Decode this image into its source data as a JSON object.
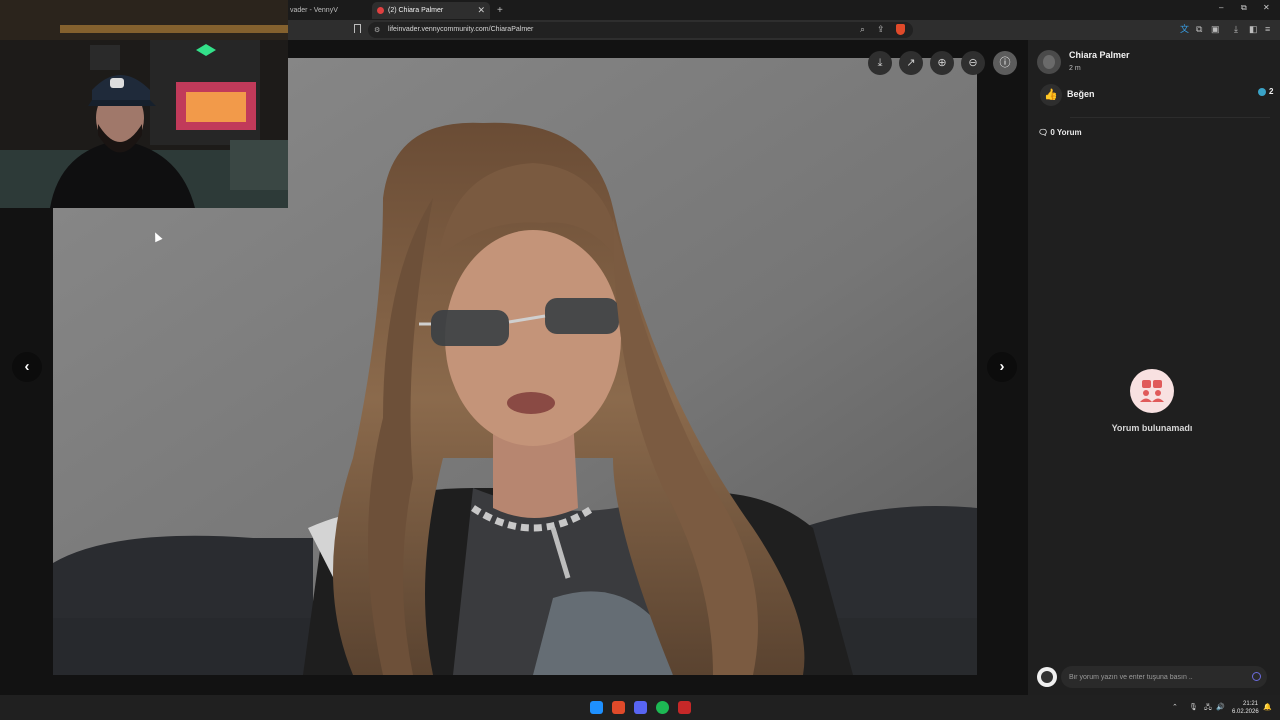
{
  "browser": {
    "tabs": [
      {
        "title": "vader - VennyV",
        "active": false
      },
      {
        "title": "(2) Chiara Palmer",
        "active": true
      }
    ],
    "url": "lifeinvader.vennycommunity.com/ChiaraPalmer",
    "window_controls": [
      "–",
      "⧉",
      "✕"
    ]
  },
  "viewer": {
    "controls": [
      "download-icon",
      "open-external-icon",
      "zoom-in-icon",
      "zoom-out-icon",
      "info-icon"
    ],
    "prev_arrow": "‹",
    "next_arrow": "›"
  },
  "post": {
    "author": "Chiara Palmer",
    "time": "2 m",
    "like_label": "Beğen",
    "like_count": "2",
    "comments_title": "0 Yorum",
    "empty_text": "Yorum bulunamadı",
    "comment_placeholder": "Bir yorum yazın ve enter tuşuna basın .."
  },
  "taskbar": {
    "time": "21:21",
    "date": "6.02.2026"
  },
  "colors": {
    "accent_like": "#3aa3c7",
    "brave_red": "#e04a2a",
    "empty_state_bg": "#f8e1e1"
  }
}
